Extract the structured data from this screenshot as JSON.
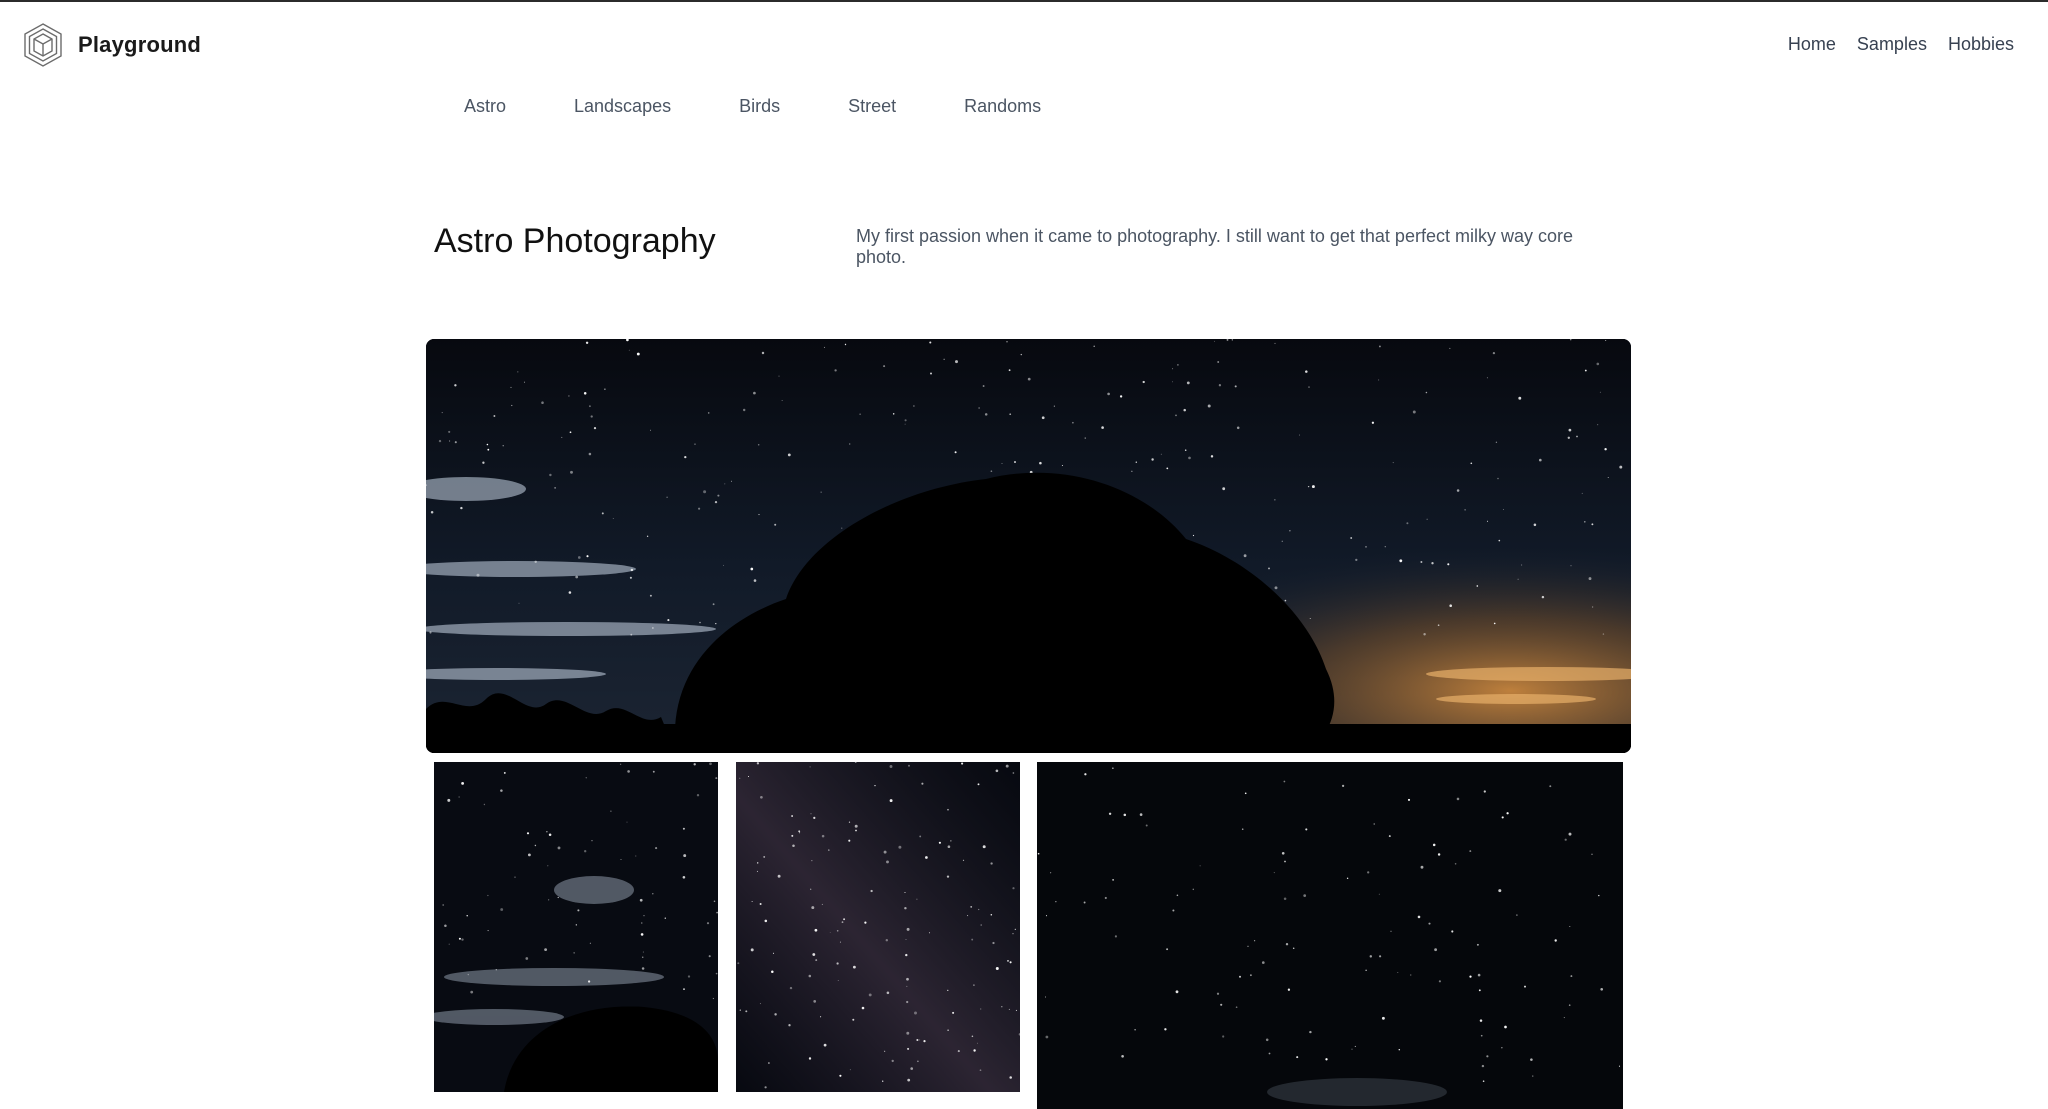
{
  "brand": {
    "name": "Playground",
    "logo_icon": "hexagon-cube-icon"
  },
  "top_nav": [
    {
      "label": "Home"
    },
    {
      "label": "Samples"
    },
    {
      "label": "Hobbies"
    }
  ],
  "sub_nav": [
    {
      "label": "Astro"
    },
    {
      "label": "Landscapes"
    },
    {
      "label": "Birds"
    },
    {
      "label": "Street"
    },
    {
      "label": "Randoms"
    }
  ],
  "section": {
    "title": "Astro Photography",
    "description": "My first passion when it came to photography. I still want to get that perfect milky way core photo."
  },
  "gallery": [
    {
      "subject": "night sky with tree silhouette and clouds"
    },
    {
      "subject": "starry sky with clouds and treeline"
    },
    {
      "subject": "milky way star field"
    },
    {
      "subject": "dark star field"
    }
  ],
  "colors": {
    "text_dark": "#111111",
    "text_muted": "#4b5563",
    "night_sky": "#0b1220",
    "glow": "#d08a3e"
  }
}
